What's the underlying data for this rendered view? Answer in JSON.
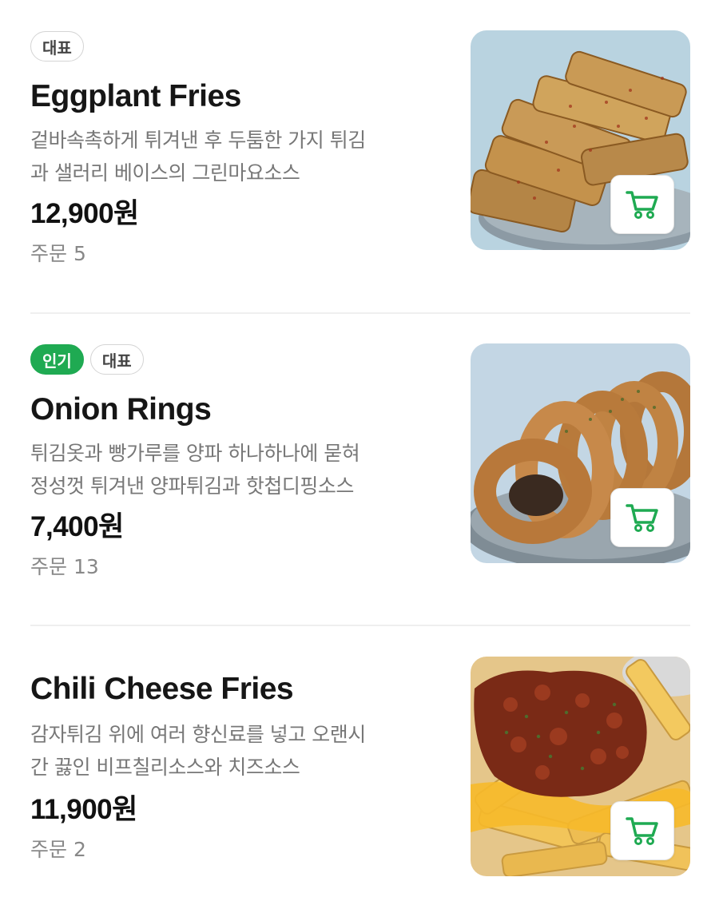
{
  "menu_items": [
    {
      "badges": [
        "대표"
      ],
      "name": "Eggplant Fries",
      "description": [
        "겉바속촉하게 튀겨낸 후 두툼한 가지 튀김",
        "과 샐러리 베이스의 그린마요소스"
      ],
      "price": "12,900원",
      "orders": "주문 5",
      "image_icon": "eggplant-fries-image"
    },
    {
      "badges": [
        "인기",
        "대표"
      ],
      "name": "Onion Rings",
      "description": [
        "튀김옷과 빵가루를 양파 하나하나에 묻혀",
        "정성껏 튀겨낸 양파튀김과 핫첩디핑소스"
      ],
      "price": "7,400원",
      "orders": "주문 13",
      "image_icon": "onion-rings-image"
    },
    {
      "badges": [],
      "name": "Chili Cheese Fries",
      "description": [
        "감자튀김 위에 여러 향신료를 넣고 오랜시",
        "간 끓인 비프칠리소스와 치즈소스"
      ],
      "price": "11,900원",
      "orders": "주문 2",
      "image_icon": "chili-cheese-fries-image"
    }
  ],
  "colors": {
    "accent_green": "#1faa52",
    "price_text": "#111111",
    "desc_text": "#777777"
  },
  "icons": {
    "cart": "shopping-cart-icon"
  }
}
